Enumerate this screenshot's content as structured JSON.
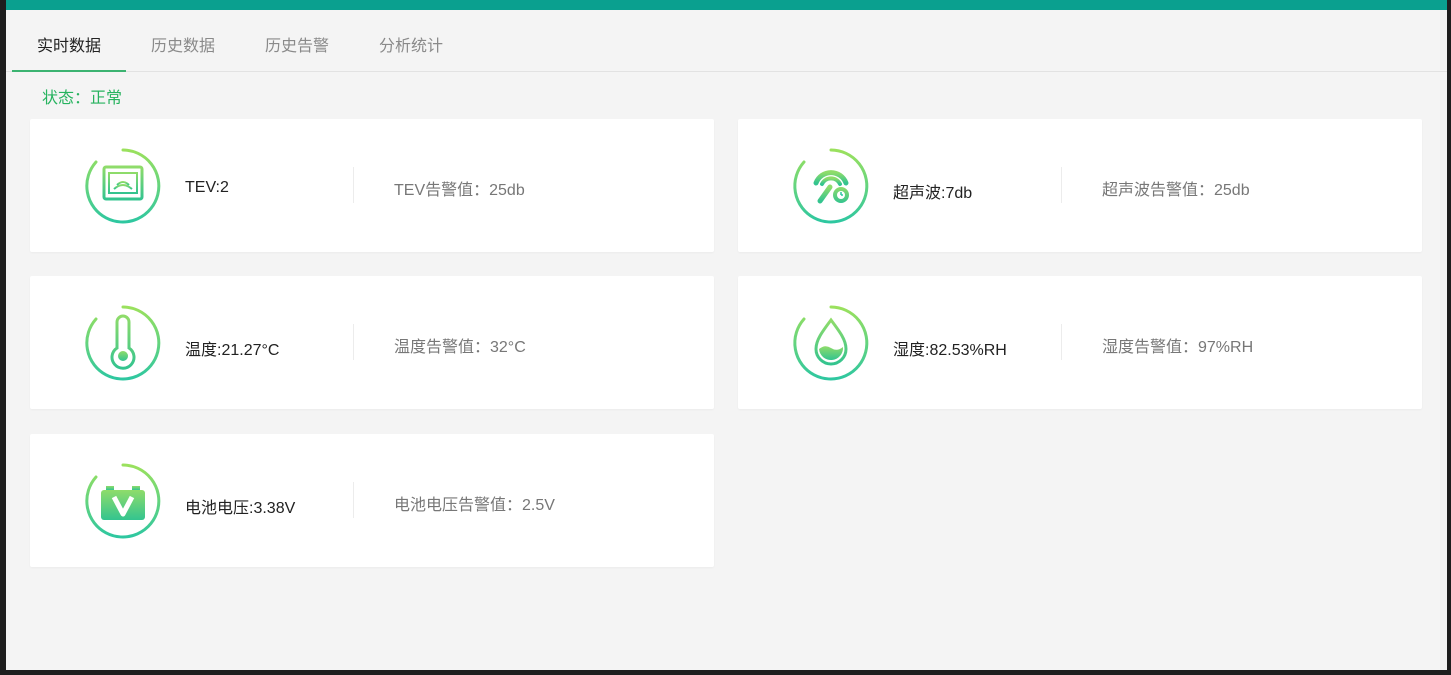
{
  "tabs": [
    {
      "label": "实时数据",
      "active": true
    },
    {
      "label": "历史数据",
      "active": false
    },
    {
      "label": "历史告警",
      "active": false
    },
    {
      "label": "分析统计",
      "active": false
    }
  ],
  "status": {
    "text": "状态：正常",
    "color": "#27b35f"
  },
  "colors": {
    "accent": "#0aa08f",
    "icon_gradient_start": "#9be15d",
    "icon_gradient_end": "#2ec7a0"
  },
  "cards": [
    {
      "icon": "tev-monitor-icon",
      "value": "TEV:2",
      "threshold": "TEV告警值：25db"
    },
    {
      "icon": "ultrasonic-sensor-icon",
      "value": "超声波:7db",
      "threshold": "超声波告警值：25db"
    },
    {
      "icon": "thermometer-icon",
      "value": "温度:21.27°C",
      "threshold": "温度告警值：32°C"
    },
    {
      "icon": "water-drop-icon",
      "value": "湿度:82.53%RH",
      "threshold": "湿度告警值：97%RH"
    },
    {
      "icon": "battery-voltage-icon",
      "value": "电池电压:3.38V",
      "threshold": "电池电压告警值：2.5V"
    }
  ]
}
